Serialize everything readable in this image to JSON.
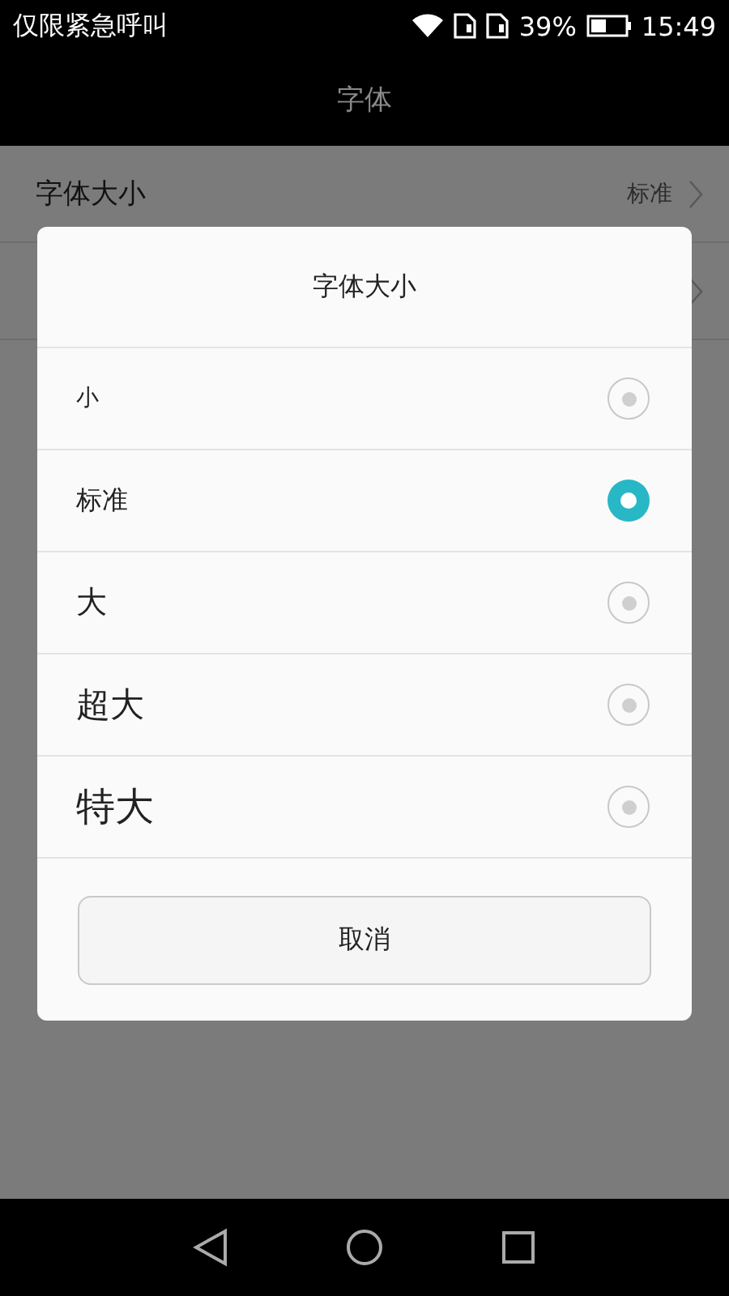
{
  "status_bar": {
    "carrier": "仅限紧急呼叫",
    "battery_percent": "39%",
    "time": "15:49"
  },
  "header": {
    "title": "字体"
  },
  "settings_row": {
    "label": "字体大小",
    "value": "标准"
  },
  "dialog": {
    "title": "字体大小",
    "options": [
      {
        "label": "小",
        "selected": false
      },
      {
        "label": "标准",
        "selected": true
      },
      {
        "label": "大",
        "selected": false
      },
      {
        "label": "超大",
        "selected": false
      },
      {
        "label": "特大",
        "selected": false
      }
    ],
    "cancel_button": "取消"
  }
}
